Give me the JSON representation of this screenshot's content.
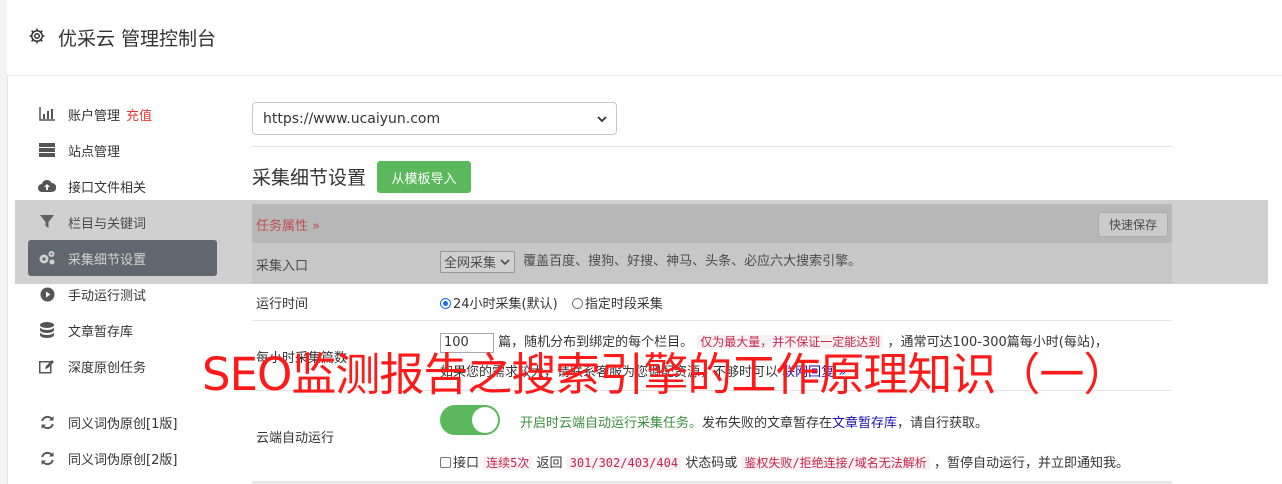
{
  "header": {
    "title": "优采云 管理控制台",
    "icon": "gear-icon"
  },
  "sidebar": {
    "items": [
      {
        "label": "账户管理",
        "badge": "充值",
        "icon": "bar-chart-icon"
      },
      {
        "label": "站点管理",
        "icon": "server-icon"
      },
      {
        "label": "接口文件相关",
        "icon": "cloud-upload-icon"
      },
      {
        "label": "栏目与关键词",
        "icon": "filter-icon"
      },
      {
        "label": "采集细节设置",
        "icon": "cogs-icon",
        "active": true
      },
      {
        "label": "手动运行测试",
        "icon": "play-circle-icon"
      },
      {
        "label": "文章暂存库",
        "icon": "database-icon"
      },
      {
        "label": "深度原创任务",
        "icon": "edit-icon"
      },
      {
        "label": "同义词伪原创[1版]",
        "icon": "refresh-icon"
      },
      {
        "label": "同义词伪原创[2版]",
        "icon": "refresh-icon"
      }
    ]
  },
  "site_select": {
    "value": "https://www.ucaiyun.com"
  },
  "section": {
    "title": "采集细节设置",
    "import_button": "从模板导入",
    "task_attr": "任务属性",
    "quick_save": "快速保存"
  },
  "rows": {
    "entry": {
      "label": "采集入口",
      "select_value": "全网采集",
      "desc": "覆盖百度、搜狗、好搜、神马、头条、必应六大搜索引擎。"
    },
    "runtime": {
      "label": "运行时间",
      "opt1": "24小时采集(默认)",
      "opt2": "指定时段采集"
    },
    "count": {
      "label": "每小时采集篇数",
      "input_value": "100",
      "text1": "篇，随机分布到绑定的每个栏目。",
      "code1": "仅为最大量，并不保证一定能达到",
      "text2": "，通常可达100-300篇每小时(每站)，",
      "text3": "如果您的需求较大，请联系客服为您调配资源，不够时可以",
      "link": "联网回复"
    },
    "cloud": {
      "label": "云端自动运行",
      "toggle_text": "开启时云端自动运行采集任务。",
      "text_a": "发布失败的文章暂存在",
      "link": "文章暂存库",
      "text_b": "，请自行获取。",
      "cb_label": "接口",
      "code1": "连续5次",
      "text_c": "返回",
      "code2": "301/302/403/404",
      "text_d": "状态码或",
      "code3": "鉴权失败/拒绝连接/域名无法解析",
      "text_e": "，暂停自动运行，并立即通知我。"
    }
  },
  "overlay_text": "SEO监测报告之搜索引擎的工作原理知识（一）",
  "colors": {
    "accent_green": "#5cb85c",
    "active_nav": "#555e6b",
    "badge_red": "#e4393c",
    "overlay_red": "#ff1a1a"
  }
}
